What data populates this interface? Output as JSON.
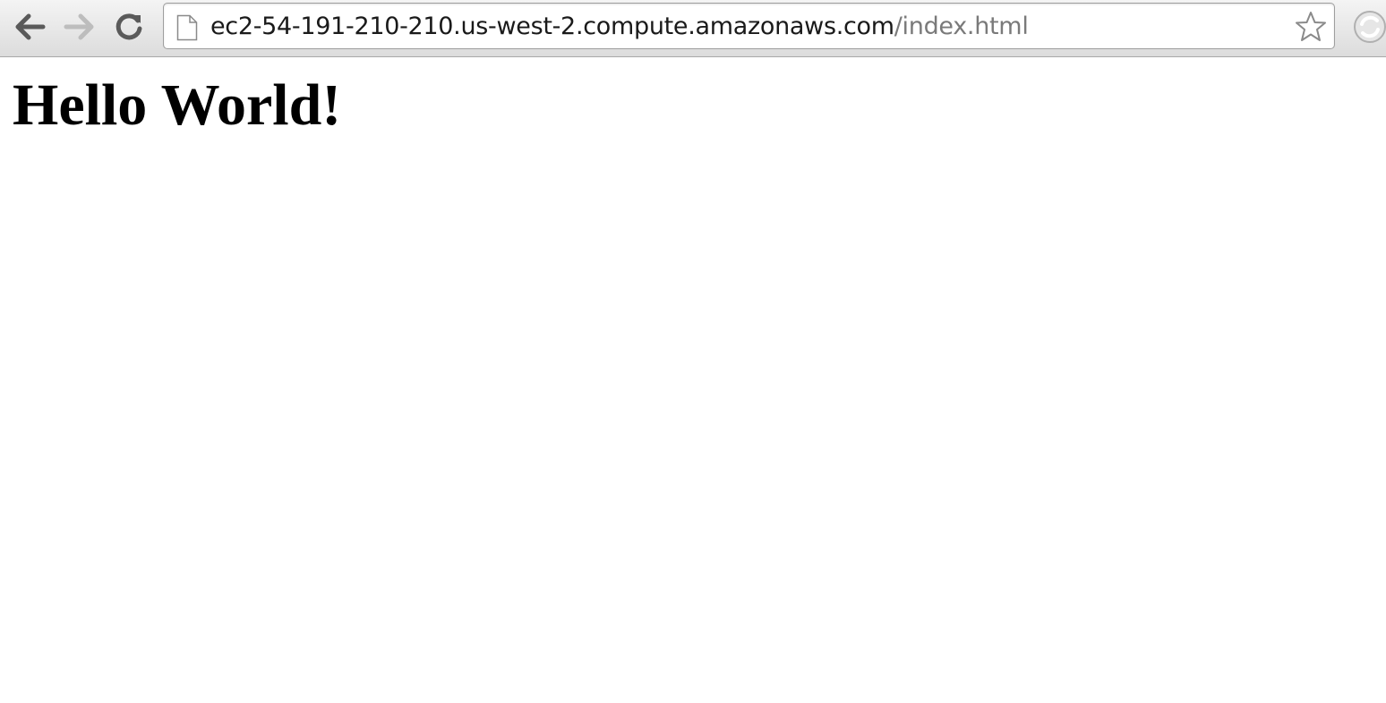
{
  "browser": {
    "toolbar": {
      "back_icon": "back-arrow-icon",
      "forward_icon": "forward-arrow-icon",
      "reload_icon": "reload-icon",
      "forward_enabled": false
    },
    "address_bar": {
      "host": "ec2-54-191-210-210.us-west-2.compute.amazonaws.com",
      "path": "/index.html",
      "page_icon": "page-icon",
      "bookmark_icon": "star-icon"
    },
    "extension_icon": "extension-icon"
  },
  "page": {
    "heading": "Hello World!"
  },
  "colors": {
    "toolbar_top": "#f4f4f4",
    "toolbar_bottom": "#dcdcdc",
    "url_host": "#1a1a1a",
    "url_path": "#7a7a7a",
    "heading": "#000000"
  }
}
